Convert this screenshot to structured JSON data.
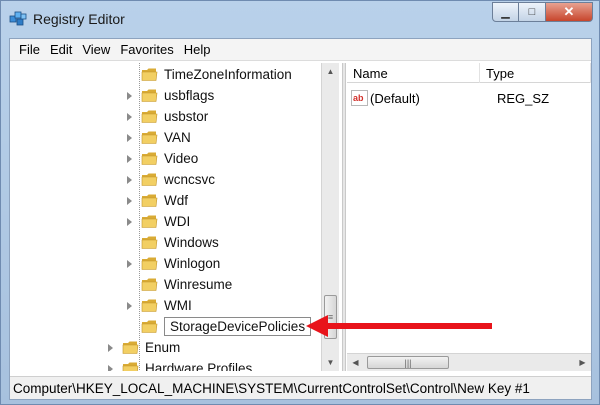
{
  "window": {
    "title": "Registry Editor",
    "minimize_glyph": "▁",
    "maximize_glyph": "□",
    "close_glyph": "✕"
  },
  "menu": [
    "File",
    "Edit",
    "View",
    "Favorites",
    "Help"
  ],
  "tree": {
    "items": [
      {
        "label": "TimeZoneInformation",
        "expandable": false
      },
      {
        "label": "usbflags",
        "expandable": true
      },
      {
        "label": "usbstor",
        "expandable": true
      },
      {
        "label": "VAN",
        "expandable": true
      },
      {
        "label": "Video",
        "expandable": true
      },
      {
        "label": "wcncsvc",
        "expandable": true
      },
      {
        "label": "Wdf",
        "expandable": true
      },
      {
        "label": "WDI",
        "expandable": true
      },
      {
        "label": "Windows",
        "expandable": false
      },
      {
        "label": "Winlogon",
        "expandable": true
      },
      {
        "label": "Winresume",
        "expandable": false
      },
      {
        "label": "WMI",
        "expandable": true
      },
      {
        "label": "StorageDevicePolicies",
        "expandable": false,
        "editing": true
      },
      {
        "label": "Enum",
        "expandable": true
      },
      {
        "label": "Hardware Profiles",
        "expandable": true
      }
    ]
  },
  "list": {
    "columns": {
      "name": "Name",
      "type": "Type"
    },
    "rows": [
      {
        "name": "(Default)",
        "type": "REG_SZ",
        "icon": "string-value-icon"
      }
    ]
  },
  "status_path": "Computer\\HKEY_LOCAL_MACHINE\\SYSTEM\\CurrentControlSet\\Control\\New Key #1",
  "colors": {
    "annotation_arrow": "#e8141b",
    "folder": "#f2cf63"
  }
}
